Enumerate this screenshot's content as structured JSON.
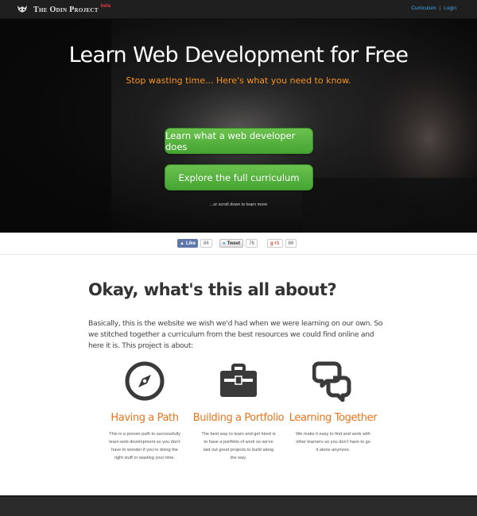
{
  "nav": {
    "brand": "The Odin Project",
    "beta": "beta",
    "curriculum": "Curriculum",
    "separator": "|",
    "login": "Login"
  },
  "hero": {
    "title": "Learn Web Development for Free",
    "subtitle": "Stop wasting time...  Here's what you need to know.",
    "button_primary": "Learn what a web developer does",
    "button_secondary": "Explore the full curriculum",
    "scroll_hint": "...or scroll down to learn more"
  },
  "social": {
    "facebook": {
      "label": "Like",
      "count": "84"
    },
    "twitter": {
      "label": "Tweet",
      "count": "76"
    },
    "google": {
      "label": "+1",
      "count": "88"
    }
  },
  "about": {
    "title": "Okay, what's this all about?",
    "text": "Basically, this is the website we wish we'd had when we were learning on our own. So we stitched together a curriculum from the best resources we could find online and here it is. This project is about:"
  },
  "features": [
    {
      "icon": "compass-icon",
      "title": "Having a Path",
      "text": "This is a proven path to successfully learn web development so you don't have to wonder if you're doing the right stuff or wasting your time."
    },
    {
      "icon": "briefcase-icon",
      "title": "Building a Portfolio",
      "text": "The best way to learn and get hired is to have a portfolio of work so we've laid out great projects to build along the way."
    },
    {
      "icon": "chat-bubbles-icon",
      "title": "Learning Together",
      "text": "We make it easy to find and work with other learners so you don't have to go it alone anymore."
    }
  ],
  "colors": {
    "accent_orange": "#e8751a",
    "button_green": "#45a533",
    "link_blue": "#3fa9f5",
    "topbar_bg": "#1f1f1f"
  }
}
